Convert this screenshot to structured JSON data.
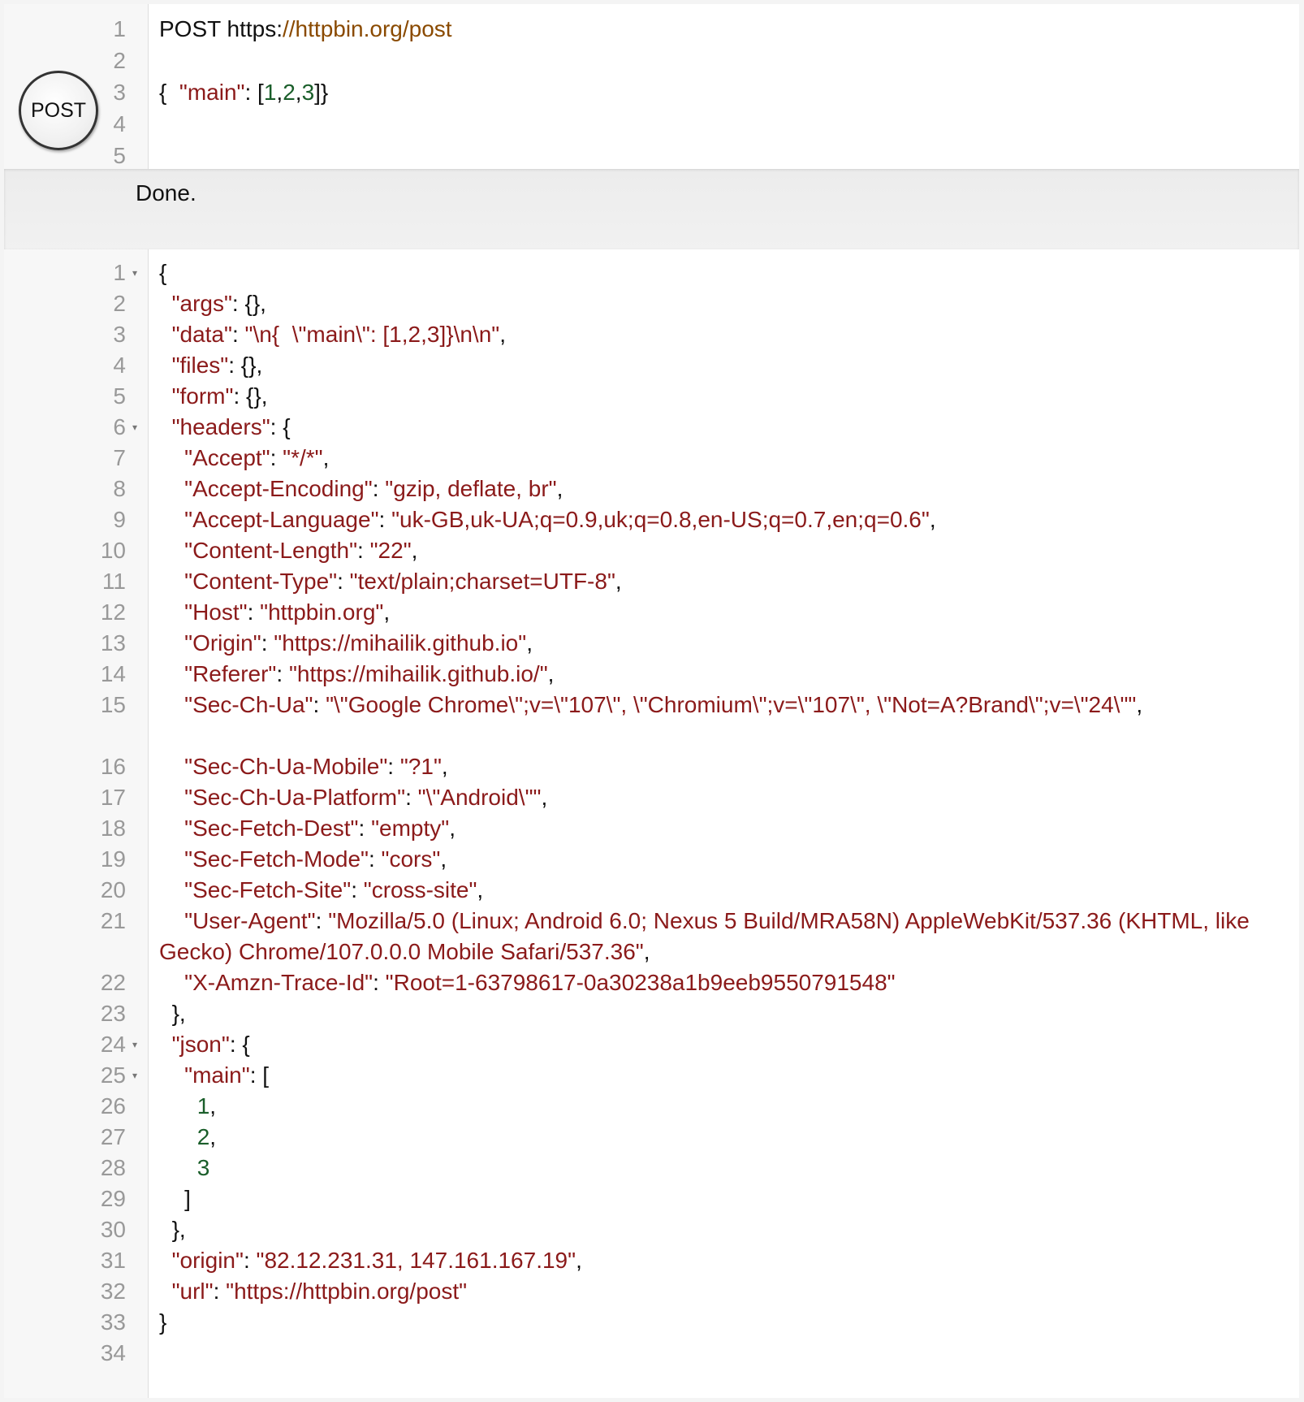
{
  "request": {
    "line_numbers": [
      "1",
      "2",
      "3",
      "4",
      "5"
    ],
    "method": "POST",
    "url_prefix": "https:",
    "url_rest": "//httpbin.org/post",
    "body_open": "{  ",
    "body_key": "\"main\"",
    "body_colon": ": [",
    "body_n1": "1",
    "body_n2": "2",
    "body_n3": "3",
    "body_close": "]}",
    "comma": ","
  },
  "post_button": {
    "label": "POST"
  },
  "status": {
    "text": "Done."
  },
  "response": {
    "line_numbers": [
      "1",
      "2",
      "3",
      "4",
      "5",
      "6",
      "7",
      "8",
      "9",
      "10",
      "11",
      "12",
      "13",
      "14",
      "15",
      "16",
      "17",
      "18",
      "19",
      "20",
      "21",
      "22",
      "23",
      "24",
      "25",
      "26",
      "27",
      "28",
      "29",
      "30",
      "31",
      "32",
      "33",
      "34"
    ],
    "fold_icon": "▾",
    "lines": {
      "l1": "{",
      "args_key": "\"args\"",
      "args_val": ": {},",
      "data_key": "\"data\"",
      "data_val": "\"\\n{  \\\"main\\\": [1,2,3]}\\n\\n\"",
      "files_key": "\"files\"",
      "files_val": ": {},",
      "form_key": "\"form\"",
      "form_val": ": {},",
      "headers_key": "\"headers\"",
      "headers_val": ": {",
      "accept_key": "\"Accept\"",
      "accept_val": "\"*/*\"",
      "acc_enc_key": "\"Accept-Encoding\"",
      "acc_enc_val": "\"gzip, deflate, br\"",
      "acc_lang_key": "\"Accept-Language\"",
      "acc_lang_val": "\"uk-GB,uk-UA;q=0.9,uk;q=0.8,en-US;q=0.7,en;q=0.6\"",
      "content_len_key": "\"Content-Length\"",
      "content_len_val": "\"22\"",
      "content_type_key": "\"Content-Type\"",
      "content_type_val": "\"text/plain;charset=UTF-8\"",
      "host_key": "\"Host\"",
      "host_val": "\"httpbin.org\"",
      "origin_h_key": "\"Origin\"",
      "origin_h_val": "\"https://mihailik.github.io\"",
      "referer_key": "\"Referer\"",
      "referer_val": "\"https://mihailik.github.io/\"",
      "sec_ch_ua_key": "\"Sec-Ch-Ua\"",
      "sec_ch_ua_val": "\"\\\"Google Chrome\\\";v=\\\"107\\\", \\\"Chromium\\\";v=\\\"107\\\", \\\"Not=A?Brand\\\";v=\\\"24\\\"\"",
      "sec_ch_mobile_key": "\"Sec-Ch-Ua-Mobile\"",
      "sec_ch_mobile_val": "\"?1\"",
      "sec_ch_platform_key": "\"Sec-Ch-Ua-Platform\"",
      "sec_ch_platform_val": "\"\\\"Android\\\"\"",
      "sec_dest_key": "\"Sec-Fetch-Dest\"",
      "sec_dest_val": "\"empty\"",
      "sec_mode_key": "\"Sec-Fetch-Mode\"",
      "sec_mode_val": "\"cors\"",
      "sec_site_key": "\"Sec-Fetch-Site\"",
      "sec_site_val": "\"cross-site\"",
      "ua_key": "\"User-Agent\"",
      "ua_val": "\"Mozilla/5.0 (Linux; Android 6.0; Nexus 5 Build/MRA58N) AppleWebKit/537.36 (KHTML, like Gecko) Chrome/107.0.0.0 Mobile Safari/537.36\"",
      "trace_key": "\"X-Amzn-Trace-Id\"",
      "trace_val": "\"Root=1-63798617-0a30238a1b9eeb9550791548\"",
      "close_obj_comma": "},",
      "json_key": "\"json\"",
      "json_val": ": {",
      "main_key": "\"main\"",
      "main_val": ": [",
      "n1": "1",
      "n2": "2",
      "n3": "3",
      "close_arr": "]",
      "origin_key": "\"origin\"",
      "origin_val": "\"82.12.231.31, 147.161.167.19\"",
      "url_key": "\"url\"",
      "url_val": "\"https://httpbin.org/post\"",
      "close_root": "}",
      "colon": ": ",
      "comma": ","
    }
  },
  "colors": {
    "key": "#8b1a1a",
    "string": "#8b1a1a",
    "number": "#1a5e2a",
    "url": "#8a4a00",
    "gutter_text": "#999999"
  }
}
